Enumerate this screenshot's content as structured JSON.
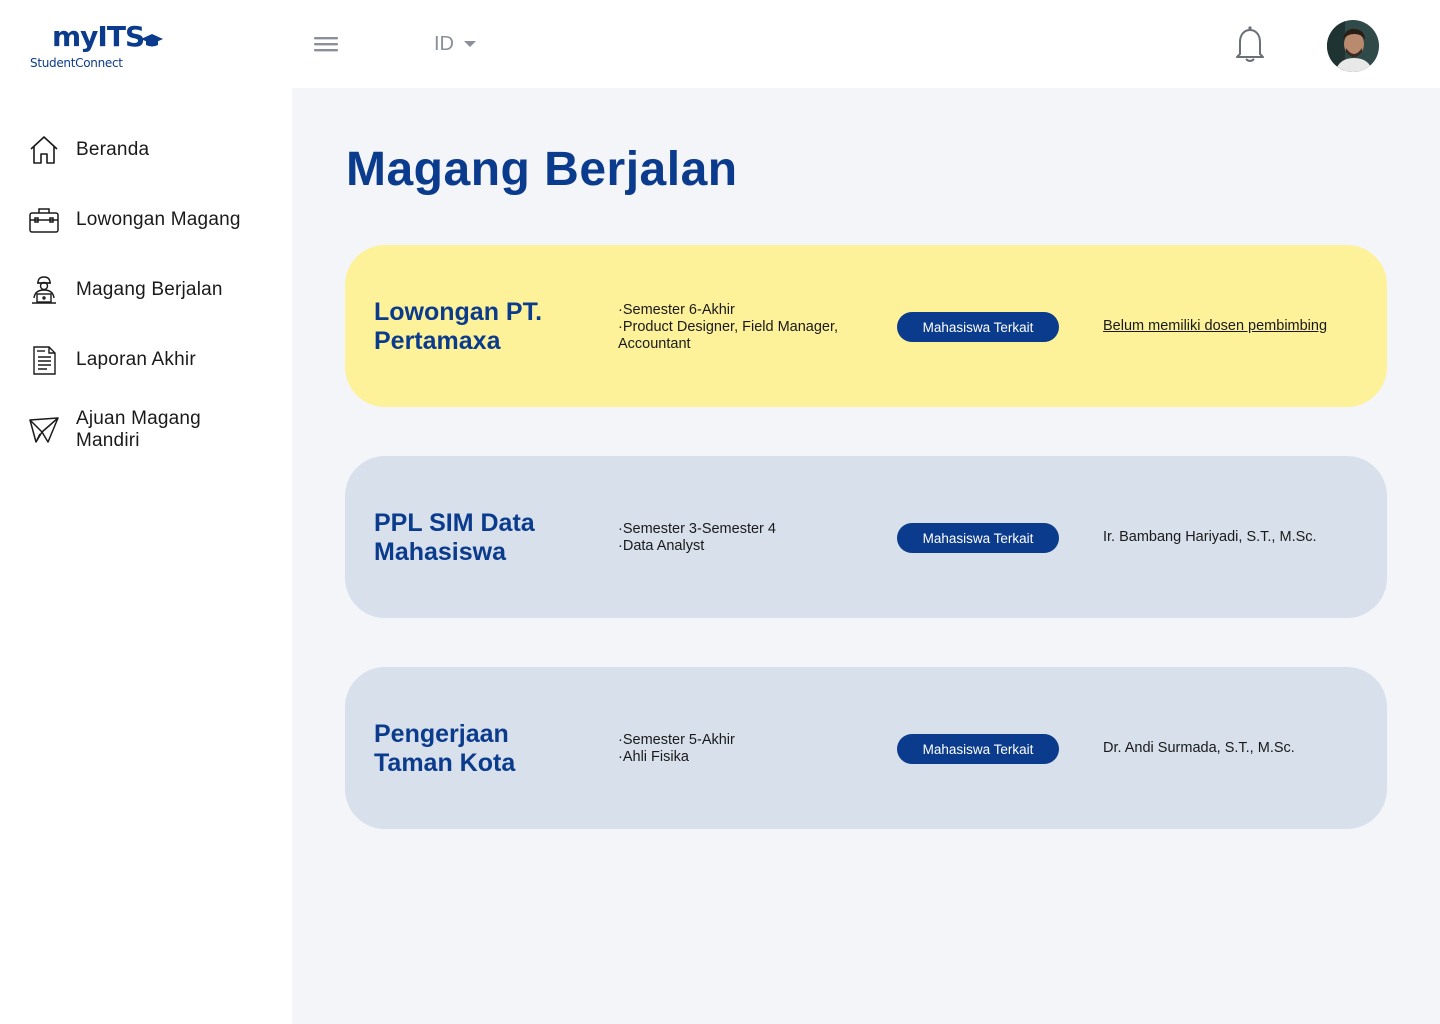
{
  "header": {
    "logo_main": "myITS",
    "logo_sub": "StudentConnect",
    "language": "ID"
  },
  "sidebar": {
    "items": [
      {
        "label": "Beranda",
        "icon": "home-icon"
      },
      {
        "label": "Lowongan Magang",
        "icon": "briefcase-icon"
      },
      {
        "label": "Magang Berjalan",
        "icon": "worker-laptop-icon"
      },
      {
        "label": "Laporan Akhir",
        "icon": "document-icon"
      },
      {
        "label": "Ajuan Magang Mandiri",
        "icon": "paper-plane-icon"
      }
    ]
  },
  "main": {
    "title": "Magang Berjalan",
    "cards": [
      {
        "title": "Lowongan PT. Pertamaxa",
        "details": [
          "Semester 6-Akhir",
          "Product Designer, Field Manager, Accountant"
        ],
        "badge": "Mahasiswa Terkait",
        "supervisor": "Belum memiliki dosen pembimbing",
        "highlight_color": "#fdf29a"
      },
      {
        "title": "PPL SIM Data Mahasiswa",
        "details": [
          "Semester 3-Semester 4",
          "Data Analyst"
        ],
        "badge": "Mahasiswa Terkait",
        "supervisor": "Ir. Bambang Hariyadi, S.T., M.Sc."
      },
      {
        "title": "Pengerjaan Taman Kota",
        "details": [
          "Semester 5-Akhir",
          "Ahli Fisika"
        ],
        "badge": "Mahasiswa Terkait",
        "supervisor": "Dr. Andi Surmada, S.T., M.Sc."
      }
    ]
  },
  "colors": {
    "brand": "#0b3b8c",
    "card_highlight": "#fdf29a",
    "card_default": "#d8e0ec",
    "main_bg": "#f3f5f9"
  }
}
